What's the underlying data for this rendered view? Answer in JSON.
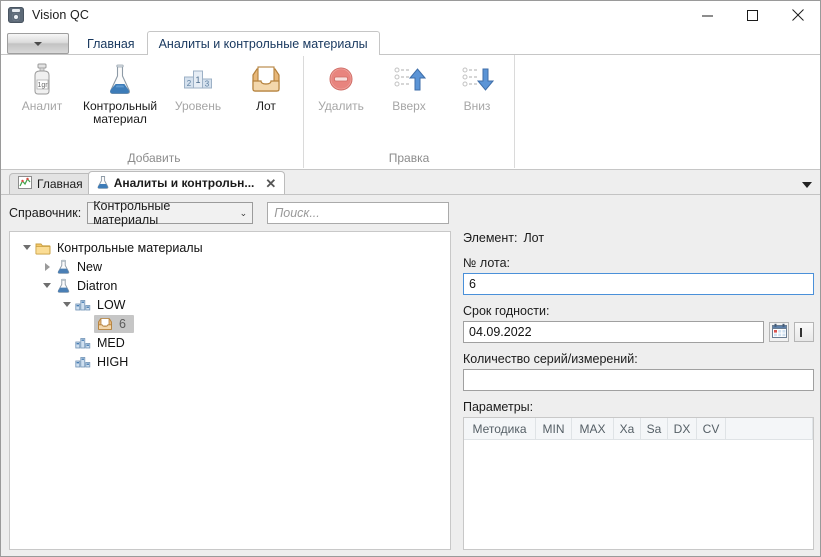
{
  "window": {
    "title": "Vision QC",
    "app_icon": "app-logo-icon",
    "controls": {
      "minimize": "minimize-icon",
      "maximize": "maximize-icon",
      "close": "close-icon"
    }
  },
  "ribbon": {
    "app_menu_icon": "chevron-down-icon",
    "tabs": [
      {
        "label": "Главная",
        "active": false
      },
      {
        "label": "Аналиты и контрольные материалы",
        "active": true
      }
    ],
    "groups": [
      {
        "label": "Добавить",
        "items": [
          {
            "label": "Аналит",
            "icon": "vial-1gr-icon",
            "disabled": true
          },
          {
            "label": "Контрольный материал",
            "icon": "flask-icon",
            "disabled": false
          },
          {
            "label": "Уровень",
            "icon": "podium-icon",
            "disabled": true
          },
          {
            "label": "Лот",
            "icon": "inbox-tray-icon",
            "disabled": false
          }
        ]
      },
      {
        "label": "Правка",
        "items": [
          {
            "label": "Удалить",
            "icon": "delete-circle-minus-icon",
            "disabled": true
          },
          {
            "label": "Вверх",
            "icon": "move-up-arrow-icon",
            "disabled": true
          },
          {
            "label": "Вниз",
            "icon": "move-down-arrow-icon",
            "disabled": true
          }
        ]
      }
    ]
  },
  "doctabs": {
    "tabs": [
      {
        "label": "Главная",
        "icon": "chart-icon",
        "active": false,
        "closable": false
      },
      {
        "label": "Аналиты и контрольн...",
        "icon": "flask-icon",
        "active": true,
        "closable": true,
        "close_glyph": "✕"
      }
    ],
    "overflow_icon": "chevron-down-icon"
  },
  "toolbar": {
    "directory_label": "Справочник:",
    "directory_value": "Контрольные материалы",
    "directory_caret": "⌄",
    "search_placeholder": "Поиск..."
  },
  "tree": {
    "nodes": [
      {
        "label": "Контрольные материалы",
        "icon": "folder-icon",
        "depth": 0,
        "state": "expanded",
        "selected": false
      },
      {
        "label": "New",
        "icon": "flask-icon",
        "depth": 1,
        "state": "collapsed",
        "selected": false
      },
      {
        "label": "Diatron",
        "icon": "flask-icon",
        "depth": 1,
        "state": "expanded",
        "selected": false
      },
      {
        "label": "LOW",
        "icon": "level-bars-icon",
        "depth": 2,
        "state": "expanded",
        "selected": false
      },
      {
        "label": "6",
        "icon": "inbox-tray-icon",
        "depth": 3,
        "state": "leaf",
        "selected": true
      },
      {
        "label": "MED",
        "icon": "level-bars-icon",
        "depth": 2,
        "state": "leaf",
        "selected": false
      },
      {
        "label": "HIGH",
        "icon": "level-bars-icon",
        "depth": 2,
        "state": "leaf",
        "selected": false
      }
    ]
  },
  "details": {
    "element_prefix": "Элемент:",
    "element_type": "Лот",
    "lot_number_label": "№ лота:",
    "lot_number_value": "6",
    "expiry_label": "Срок годности:",
    "expiry_value": "04.09.2022",
    "calendar_icon": "calendar-icon",
    "clear_icon": "cursor-bar-icon",
    "series_label": "Количество серий/измерений:",
    "series_value": "",
    "parameters_label": "Параметры:",
    "parameters_table": {
      "columns": [
        "Методика",
        "MIN",
        "MAX",
        "Xa",
        "Sa",
        "DX",
        "CV"
      ],
      "rows": []
    }
  },
  "colors": {
    "accent_blue": "#4a90d9",
    "tab_text": "#17375e",
    "selection_gray": "#c6c6c6",
    "chrome_gray": "#eeeeee",
    "delete_red": "#e8827c",
    "arrow_blue": "#4a80c4"
  }
}
